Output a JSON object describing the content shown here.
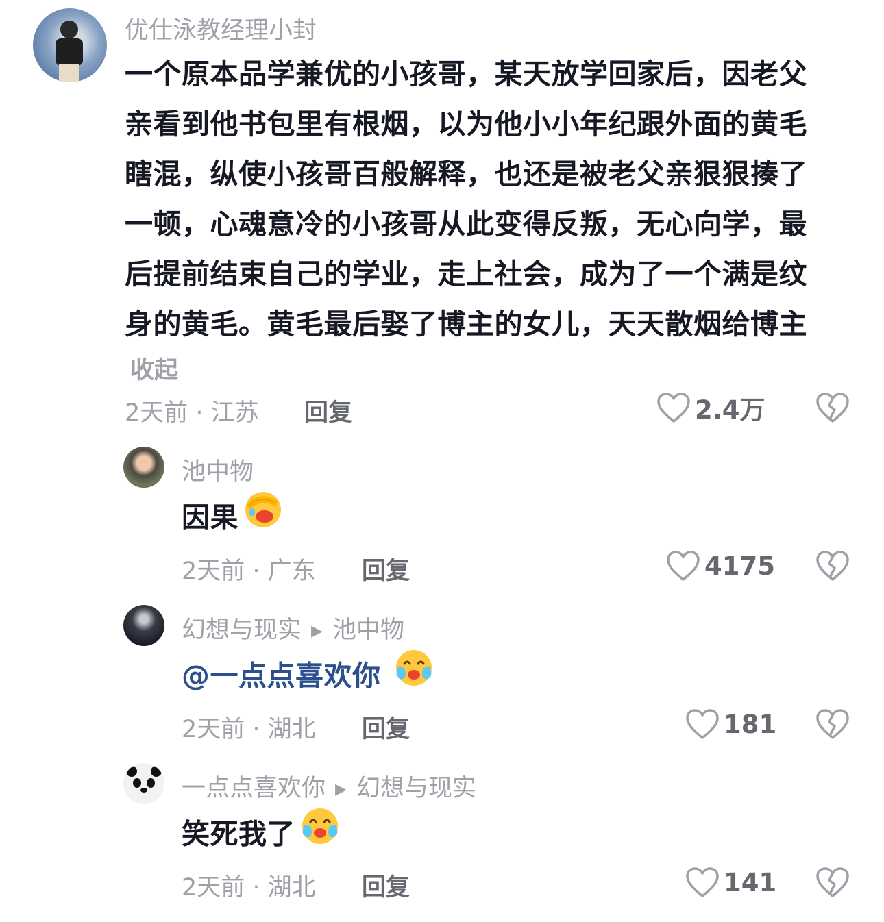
{
  "comments": [
    {
      "author": "优仕泳教经理小封",
      "text_lines": [
        "一个原本品学兼优的小孩哥，某天放学回家后，因老父",
        "亲看到他书包里有根烟，以为他小小年纪跟外面的黄毛",
        "瞎混，纵使小孩哥百般解释，也还是被老父亲狠狠揍了",
        "一顿，心魂意冷的小孩哥从此变得反叛，无心向学，最",
        "后提前结束自己的学业，走上社会，成为了一个满是纹",
        "身的黄毛。黄毛最后娶了博主的女儿，天天散烟给博主"
      ],
      "fold_label": "收起",
      "meta": "2天前 · 江苏",
      "reply_label": "回复",
      "likes": "2.4万"
    },
    {
      "author": "池中物",
      "text": "因果",
      "emoji": "face-palm-emoji",
      "meta": "2天前 · 广东",
      "reply_label": "回复",
      "likes": "4175"
    },
    {
      "author": "幻想与现实",
      "reply_to": "池中物",
      "text": "@一点点喜欢你",
      "emoji": "crying-laughing-emoji",
      "meta": "2天前 · 湖北",
      "reply_label": "回复",
      "likes": "181"
    },
    {
      "author": "一点点喜欢你",
      "reply_to": "幻想与现实",
      "text": "笑死我了",
      "emoji": "crying-laughing-emoji",
      "meta": "2天前 · 湖北",
      "reply_label": "回复",
      "likes": "141"
    }
  ],
  "colors": {
    "primary_text": "#161823",
    "secondary_text": "#a0a1a8",
    "mention": "#2b4f8f",
    "action_text": "#666870"
  }
}
